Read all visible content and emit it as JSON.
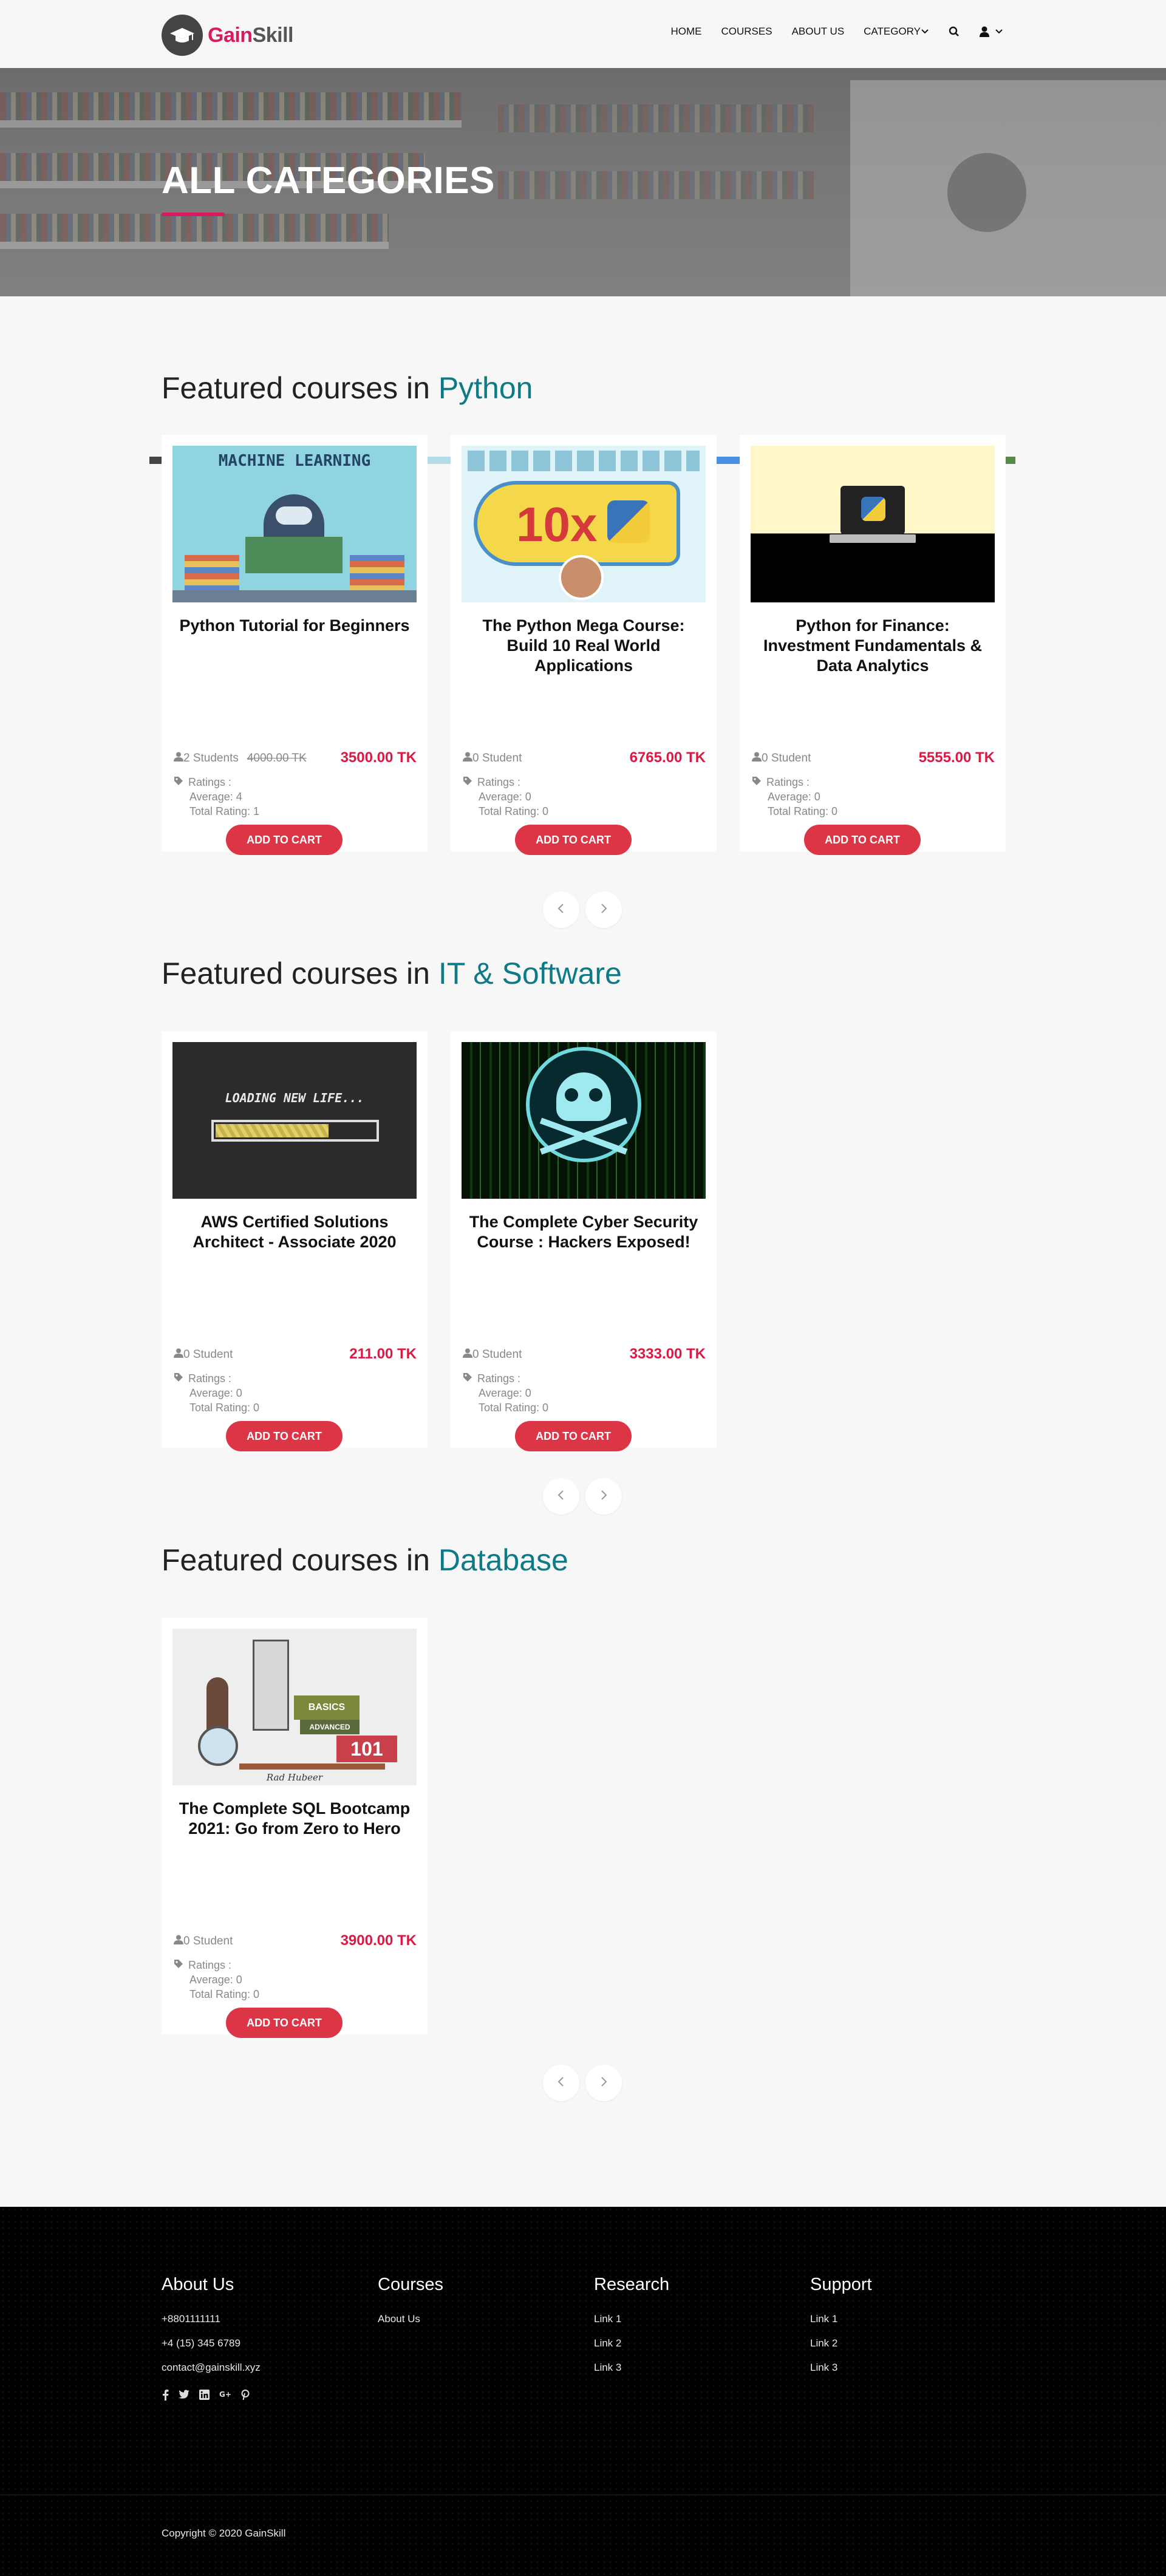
{
  "brand": {
    "name_part1": "Gain",
    "name_part2": "Skill"
  },
  "nav": {
    "home": "HOME",
    "courses": "COURSES",
    "about": "ABOUT US",
    "category": "CATEGORY"
  },
  "hero": {
    "title": "ALL CATEGORIES"
  },
  "sections": [
    {
      "prefix": "Featured courses in",
      "category": "Python",
      "courses": [
        {
          "title": "Python Tutorial for Beginners",
          "students": "2 Students",
          "old_price": "4000.00 TK",
          "price": "3500.00 TK",
          "ratings_label": "Ratings :",
          "average": "Average: 4",
          "total": "Total Rating: 1",
          "cart": "ADD TO CART",
          "thumb_text": "MACHINE LEARNING"
        },
        {
          "title": "The Python Mega Course: Build 10 Real World Applications",
          "students": "0 Student",
          "price": "6765.00 TK",
          "ratings_label": "Ratings :",
          "average": "Average: 0",
          "total": "Total Rating: 0",
          "cart": "ADD TO CART",
          "thumb_text": "10x"
        },
        {
          "title": "Python for Finance: Investment Fundamentals & Data Analytics",
          "students": "0 Student",
          "price": "5555.00 TK",
          "ratings_label": "Ratings :",
          "average": "Average: 0",
          "total": "Total Rating: 0",
          "cart": "ADD TO CART"
        }
      ]
    },
    {
      "prefix": "Featured courses in",
      "category": "IT & Software",
      "courses": [
        {
          "title": "AWS Certified Solutions Architect - Associate 2020",
          "students": "0 Student",
          "price": "211.00 TK",
          "ratings_label": "Ratings :",
          "average": "Average: 0",
          "total": "Total Rating: 0",
          "cart": "ADD TO CART",
          "thumb_text": "LOADING NEW LIFE..."
        },
        {
          "title": "The Complete Cyber Security Course : Hackers Exposed!",
          "students": "0 Student",
          "price": "3333.00 TK",
          "ratings_label": "Ratings :",
          "average": "Average: 0",
          "total": "Total Rating: 0",
          "cart": "ADD TO CART"
        }
      ]
    },
    {
      "prefix": "Featured courses in",
      "category": "Database",
      "courses": [
        {
          "title": "The Complete SQL Bootcamp 2021: Go from Zero to Hero",
          "students": "0 Student",
          "price": "3900.00 TK",
          "ratings_label": "Ratings :",
          "average": "Average: 0",
          "total": "Total Rating: 0",
          "cart": "ADD TO CART",
          "thumb_text": "101",
          "thumb_sub": "Rad Hubeer",
          "thumb_basics": "BASICS",
          "thumb_adv": "ADVANCED"
        }
      ]
    }
  ],
  "footer": {
    "about": {
      "heading": "About Us",
      "phone1": "+8801111111",
      "phone2": "+4 (15) 345 6789",
      "email": "contact@gainskill.xyz"
    },
    "courses": {
      "heading": "Courses",
      "link1": "About Us"
    },
    "research": {
      "heading": "Research",
      "link1": "Link 1",
      "link2": "Link 2",
      "link3": "Link 3"
    },
    "support": {
      "heading": "Support",
      "link1": "Link 1",
      "link2": "Link 2",
      "link3": "Link 3"
    },
    "social_icons": [
      "facebook-icon",
      "twitter-icon",
      "linkedin-icon",
      "google-plus-icon",
      "pinterest-icon"
    ],
    "copyright": "Copyright © 2020 GainSkill"
  },
  "colors": {
    "accent": "#d81b60",
    "teal": "#0d7a86",
    "price": "#d81b44",
    "cart": "#dc3545"
  }
}
